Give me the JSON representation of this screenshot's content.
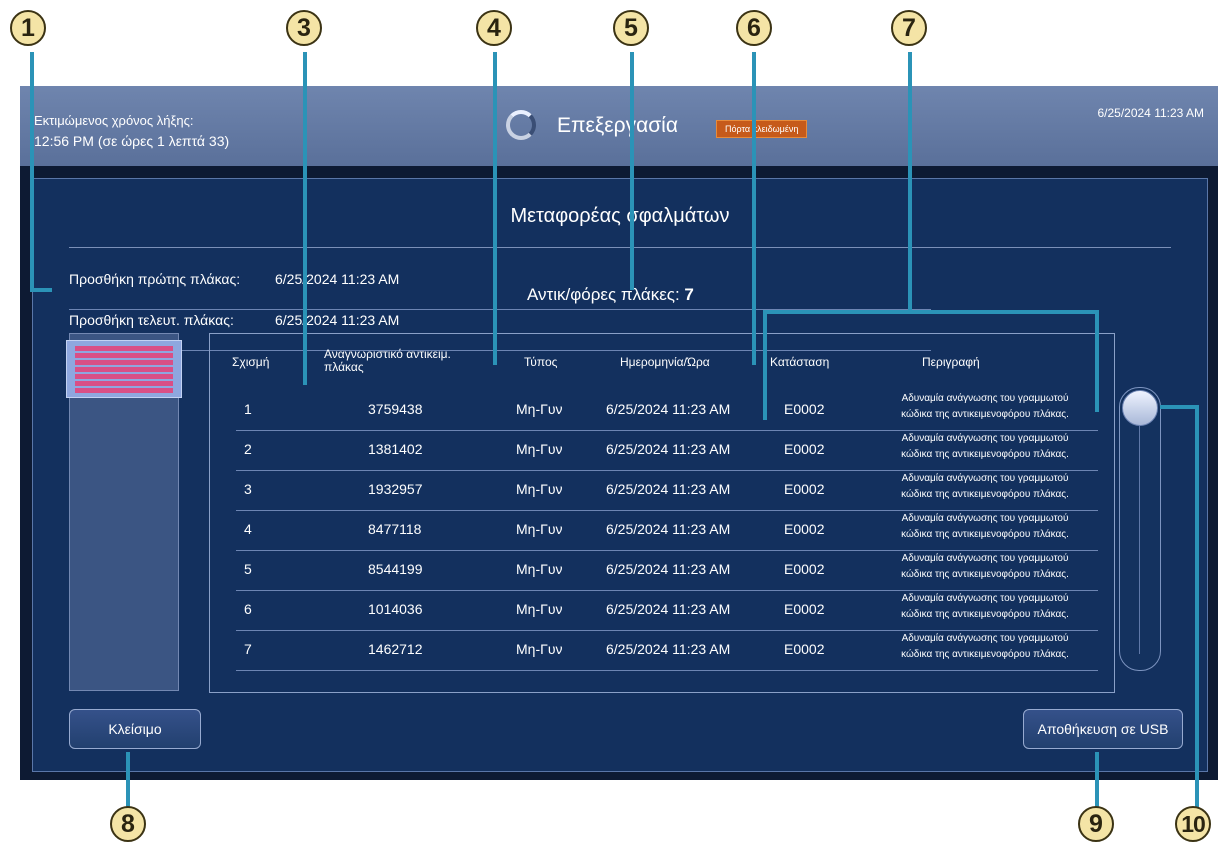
{
  "top_bar": {
    "estimate_label": "Εκτιμώμενος χρόνος λήξης:",
    "estimate_value": "12:56 PM (σε ώρες 1 λεπτά 33)",
    "status_title": "Επεξεργασία",
    "door_badge": "Πόρτα κλειδωμένη",
    "clock": "6/25/2024 11:23 AM"
  },
  "dialog": {
    "title": "Μεταφορέας σφαλμάτων",
    "first_plate_label": "Προσθήκη πρώτης πλάκας:",
    "first_plate_value": "6/25/2024 11:23 AM",
    "last_plate_label": "Προσθήκη τελευτ. πλάκας:",
    "last_plate_value": "6/25/2024 11:23 AM",
    "count_label": "Αντικ/φόρες πλάκες:",
    "count_value": "7",
    "close_button": "Κλείσιμο",
    "usb_button": "Αποθήκευση σε USB"
  },
  "table": {
    "headers": {
      "slot": "Σχισμή",
      "plate_id": "Αναγνωριστικό αντικειμ. πλάκας",
      "type": "Τύπος",
      "datetime": "Ημερομηνία/Ώρα",
      "status": "Κατάσταση",
      "description": "Περιγραφή"
    },
    "rows": [
      {
        "slot": "1",
        "plate_id": "3759438",
        "type": "Μη-Γυν",
        "datetime": "6/25/2024 11:23 AM",
        "status": "E0002",
        "desc_line1": "Αδυναμία ανάγνωσης του γραμμωτού",
        "desc_line2": "κώδικα της αντικειμενοφόρου πλάκας."
      },
      {
        "slot": "2",
        "plate_id": "1381402",
        "type": "Μη-Γυν",
        "datetime": "6/25/2024 11:23 AM",
        "status": "E0002",
        "desc_line1": "Αδυναμία ανάγνωσης του γραμμωτού",
        "desc_line2": "κώδικα της αντικειμενοφόρου πλάκας."
      },
      {
        "slot": "3",
        "plate_id": "1932957",
        "type": "Μη-Γυν",
        "datetime": "6/25/2024 11:23 AM",
        "status": "E0002",
        "desc_line1": "Αδυναμία ανάγνωσης του γραμμωτού",
        "desc_line2": "κώδικα της αντικειμενοφόρου πλάκας."
      },
      {
        "slot": "4",
        "plate_id": "8477118",
        "type": "Μη-Γυν",
        "datetime": "6/25/2024 11:23 AM",
        "status": "E0002",
        "desc_line1": "Αδυναμία ανάγνωσης του γραμμωτού",
        "desc_line2": "κώδικα της αντικειμενοφόρου πλάκας."
      },
      {
        "slot": "5",
        "plate_id": "8544199",
        "type": "Μη-Γυν",
        "datetime": "6/25/2024 11:23 AM",
        "status": "E0002",
        "desc_line1": "Αδυναμία ανάγνωσης του γραμμωτού",
        "desc_line2": "κώδικα της αντικειμενοφόρου πλάκας."
      },
      {
        "slot": "6",
        "plate_id": "1014036",
        "type": "Μη-Γυν",
        "datetime": "6/25/2024 11:23 AM",
        "status": "E0002",
        "desc_line1": "Αδυναμία ανάγνωσης του γραμμωτού",
        "desc_line2": "κώδικα της αντικειμενοφόρου πλάκας."
      },
      {
        "slot": "7",
        "plate_id": "1462712",
        "type": "Μη-Γυν",
        "datetime": "6/25/2024 11:23 AM",
        "status": "E0002",
        "desc_line1": "Αδυναμία ανάγνωσης του γραμμωτού",
        "desc_line2": "κώδικα της αντικειμενοφόρου πλάκας."
      }
    ]
  },
  "callouts": [
    "1",
    "3",
    "4",
    "5",
    "6",
    "7",
    "8",
    "9",
    "10"
  ],
  "colors": {
    "callout_fill": "#f4e4a6",
    "leader_line": "#2b93b7",
    "badge": "#c65a1a",
    "minimap_mark": "#d94f86"
  },
  "icons": {
    "spinner": "processing-spinner-icon"
  }
}
